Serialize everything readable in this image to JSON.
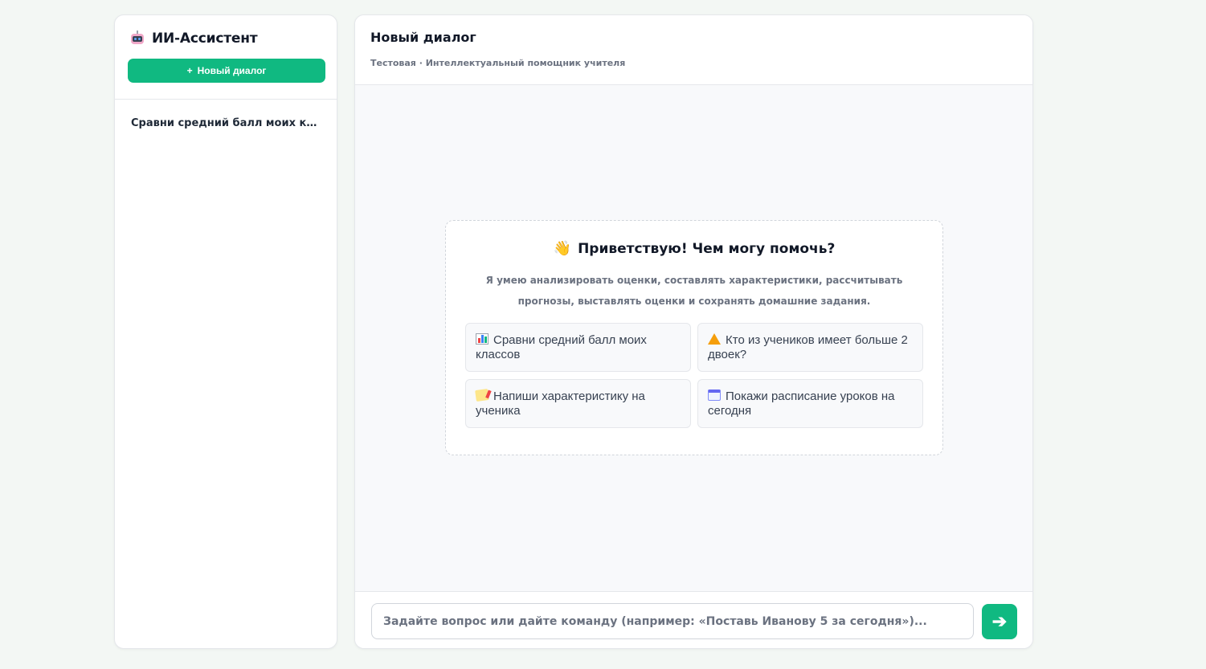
{
  "sidebar": {
    "brand_title": "ИИ-Ассистент",
    "brand_icon": "robot-icon",
    "new_dialog_label": "Новый диалог",
    "new_dialog_plus": "+",
    "history": [
      {
        "label": "Сравни средний балл моих кла..."
      }
    ]
  },
  "main": {
    "title": "Новый диалог",
    "subtitle": "Тестовая · Интеллектуальный помощник учителя"
  },
  "welcome": {
    "icon": "👋",
    "title": "Приветствую! Чем могу помочь?",
    "text": "Я умею анализировать оценки, составлять характеристики, рассчитывать прогнозы, выставлять оценки и сохранять домашние задания.",
    "suggestions": [
      {
        "icon": "bar-chart-icon",
        "label": "Сравни средний балл моих классов"
      },
      {
        "icon": "warning-icon",
        "label": "Кто из учеников имеет больше 2 двоек?"
      },
      {
        "icon": "memo-icon",
        "label": "Напиши характеристику на ученика"
      },
      {
        "icon": "calendar-icon",
        "label": "Покажи расписание уроков на сегодня"
      }
    ]
  },
  "composer": {
    "placeholder": "Задайте вопрос или дайте команду (например: «Поставь Иванову 5 за сегодня»)...",
    "value": "",
    "send_symbol": "➔"
  },
  "colors": {
    "accent": "#10b981",
    "background": "#f3f7f4"
  }
}
